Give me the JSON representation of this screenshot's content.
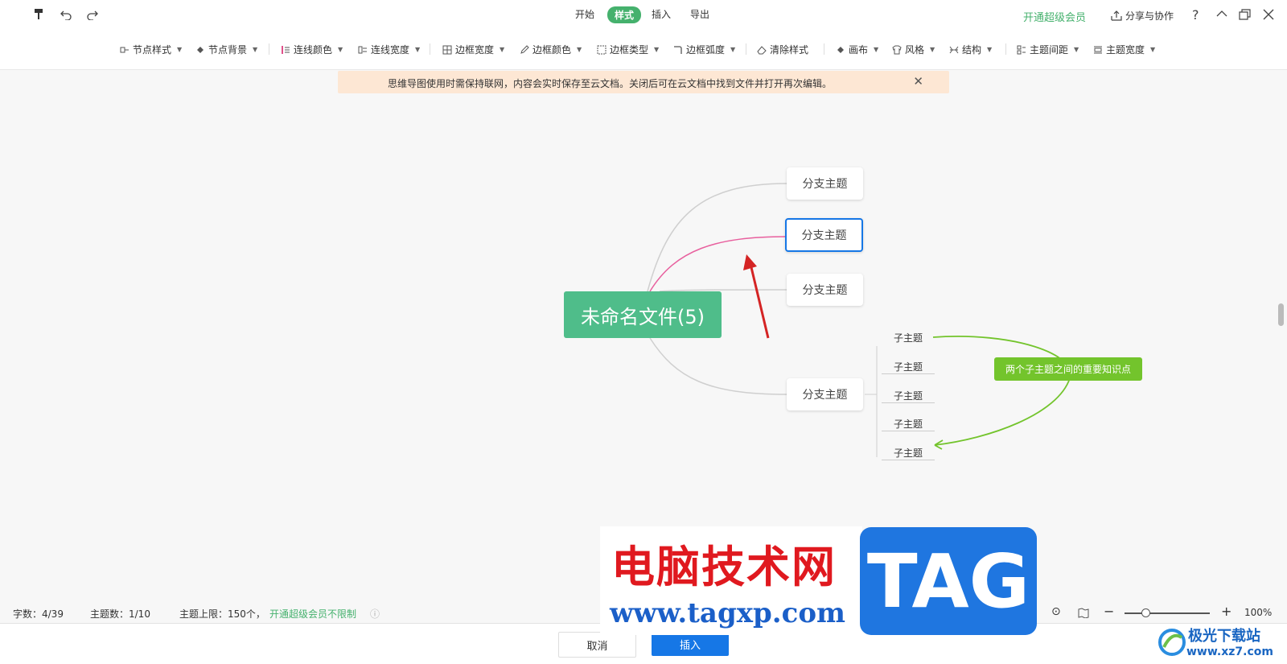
{
  "topbar": {
    "tabs": [
      "开始",
      "样式",
      "插入",
      "导出"
    ],
    "active_tab": "样式",
    "vip": "开通超级会员",
    "share": "分享与协作",
    "help": "?"
  },
  "toolbar": {
    "items": [
      "节点样式",
      "节点背景",
      "连线颜色",
      "连线宽度",
      "边框宽度",
      "边框颜色",
      "边框类型",
      "边框弧度",
      "清除样式",
      "画布",
      "风格",
      "结构",
      "主题间距",
      "主题宽度"
    ]
  },
  "notice": {
    "text": "思维导图使用时需保持联网，内容会实时保存至云文档。关闭后可在云文档中找到文件并打开再次编辑。"
  },
  "mindmap": {
    "root": "未命名文件(5)",
    "branches": [
      "分支主题",
      "分支主题",
      "分支主题",
      "分支主题"
    ],
    "subtopics": [
      "子主题",
      "子主题",
      "子主题",
      "子主题",
      "子主题"
    ],
    "callout": "两个子主题之间的重要知识点",
    "colors": {
      "root": "#4fbd8a",
      "selected_line": "#e8609e",
      "callout": "#73c42c",
      "selected_border": "#1677e6"
    }
  },
  "status": {
    "chars": "字数：4/39",
    "topics": "主题数：1/10",
    "limit": "主题上限：150个，",
    "vip_link": "开通超级会员不限制",
    "zoom": "100%"
  },
  "footer": {
    "cancel": "取消",
    "insert": "插入"
  },
  "watermark": {
    "title": "电脑技术网",
    "url": "www.tagxp.com",
    "tag": "TAG",
    "site": "极光下载站",
    "site_url": "www.xz7.com"
  }
}
